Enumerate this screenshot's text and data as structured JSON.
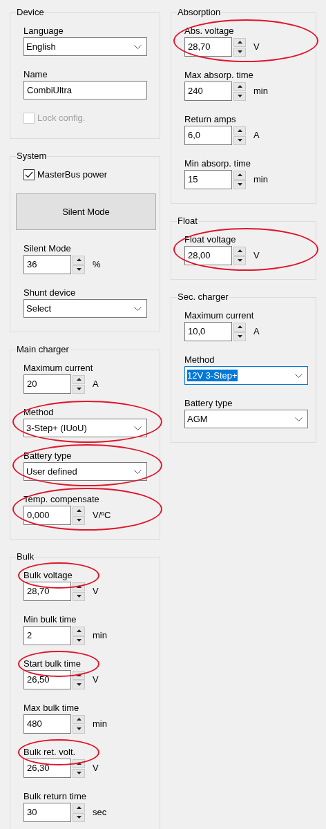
{
  "columns": [
    {
      "groups": [
        {
          "title": "Device",
          "items": [
            {
              "kind": "combo",
              "label": "Language",
              "value": "English"
            },
            {
              "kind": "text",
              "label": "Name",
              "value": "CombiUltra"
            },
            {
              "kind": "checkbox",
              "label": "Lock config.",
              "checked": false,
              "disabled": true
            }
          ]
        },
        {
          "title": "System",
          "items": [
            {
              "kind": "checkbox",
              "label": "MasterBus power",
              "checked": true,
              "disabled": false
            },
            {
              "kind": "button",
              "label": "Silent Mode"
            },
            {
              "kind": "spin",
              "label": "Silent Mode",
              "value": "36",
              "unit": "%"
            },
            {
              "kind": "combo",
              "label": "Shunt device",
              "value": "Select"
            }
          ]
        },
        {
          "title": "Main charger",
          "items": [
            {
              "kind": "spin",
              "label": "Maximum current",
              "value": "20",
              "unit": "A"
            },
            {
              "kind": "combo",
              "label": "Method",
              "value": "3-Step+ (IUoU)",
              "circled": true
            },
            {
              "kind": "combo",
              "label": "Battery type",
              "value": "User defined",
              "circled": true
            },
            {
              "kind": "spin",
              "label": "Temp. compensate",
              "value": "0,000",
              "unit": "V/ºC",
              "circled": true
            }
          ]
        },
        {
          "title": "Bulk",
          "items": [
            {
              "kind": "spin",
              "label": "Bulk voltage",
              "value": "28,70",
              "unit": "V",
              "label_circled": true
            },
            {
              "kind": "spin",
              "label": "Min bulk time",
              "value": "2",
              "unit": "min"
            },
            {
              "kind": "spin",
              "label": "Start bulk time",
              "value": "26,50",
              "unit": "V",
              "label_circled": true
            },
            {
              "kind": "spin",
              "label": "Max bulk time",
              "value": "480",
              "unit": "min"
            },
            {
              "kind": "spin",
              "label": "Bulk ret. volt.",
              "value": "26,30",
              "unit": "V",
              "label_circled": true
            },
            {
              "kind": "spin",
              "label": "Bulk return time",
              "value": "30",
              "unit": "sec"
            }
          ]
        }
      ]
    },
    {
      "groups": [
        {
          "title": "Absorption",
          "items": [
            {
              "kind": "spin",
              "label": "Abs. voltage",
              "value": "28,70",
              "unit": "V",
              "circled": true
            },
            {
              "kind": "spin",
              "label": "Max absorp. time",
              "value": "240",
              "unit": "min"
            },
            {
              "kind": "spin",
              "label": "Return amps",
              "value": "6,0",
              "unit": "A"
            },
            {
              "kind": "spin",
              "label": "Min absorp. time",
              "value": "15",
              "unit": "min"
            }
          ]
        },
        {
          "title": "Float",
          "items": [
            {
              "kind": "spin",
              "label": "Float voltage",
              "value": "28,00",
              "unit": "V",
              "circled": true
            }
          ]
        },
        {
          "title": "Sec. charger",
          "items": [
            {
              "kind": "spin",
              "label": "Maximum current",
              "value": "10,0",
              "unit": "A"
            },
            {
              "kind": "combo",
              "label": "Method",
              "value": "12V 3-Step+",
              "focused": true
            },
            {
              "kind": "combo",
              "label": "Battery type",
              "value": "AGM"
            }
          ]
        }
      ]
    }
  ]
}
